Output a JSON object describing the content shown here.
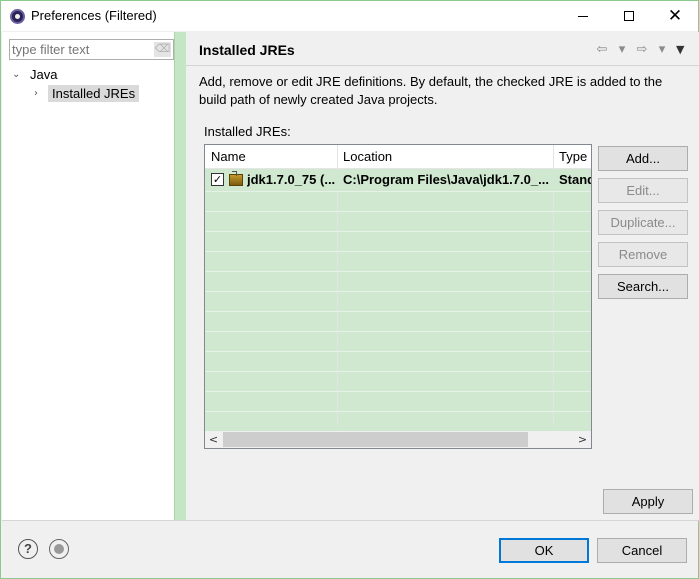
{
  "window": {
    "title": "Preferences (Filtered)",
    "minimize_glyph": "—",
    "maximize_glyph": "□",
    "close_glyph": "✕"
  },
  "sidebar": {
    "filter_placeholder": "type filter text",
    "filter_value": "",
    "clear_icon": "eraser-icon",
    "tree": [
      {
        "label": "Java",
        "expanded": true,
        "chevron": "⌄"
      },
      {
        "label": "Installed JREs",
        "selected": true,
        "chevron": "›"
      }
    ]
  },
  "page": {
    "title": "Installed JREs",
    "nav_back": "⇦",
    "nav_back_menu": "▾",
    "nav_forward": "⇨",
    "nav_forward_menu": "▾",
    "view_menu": "▼",
    "description": "Add, remove or edit JRE definitions. By default, the checked JRE is added to the build path of newly created Java projects.",
    "table_label": "Installed JREs:",
    "columns": [
      "Name",
      "Location",
      "Type"
    ],
    "rows": [
      {
        "checked": true,
        "checkmark": "✓",
        "name": "jdk1.7.0_75 (...",
        "location": "C:\\Program Files\\Java\\jdk1.7.0_...",
        "type": "Stand"
      }
    ],
    "scroll_left": "<",
    "scroll_right": ">",
    "buttons": {
      "add": "Add...",
      "edit": "Edit...",
      "duplicate": "Duplicate...",
      "remove": "Remove",
      "search": "Search...",
      "apply": "Apply"
    }
  },
  "footer": {
    "help_glyph": "?",
    "ok": "OK",
    "cancel": "Cancel"
  },
  "colors": {
    "accent_green": "#cfe8cf",
    "frame_green": "#8cc98c",
    "default_button_border": "#0078d7"
  }
}
